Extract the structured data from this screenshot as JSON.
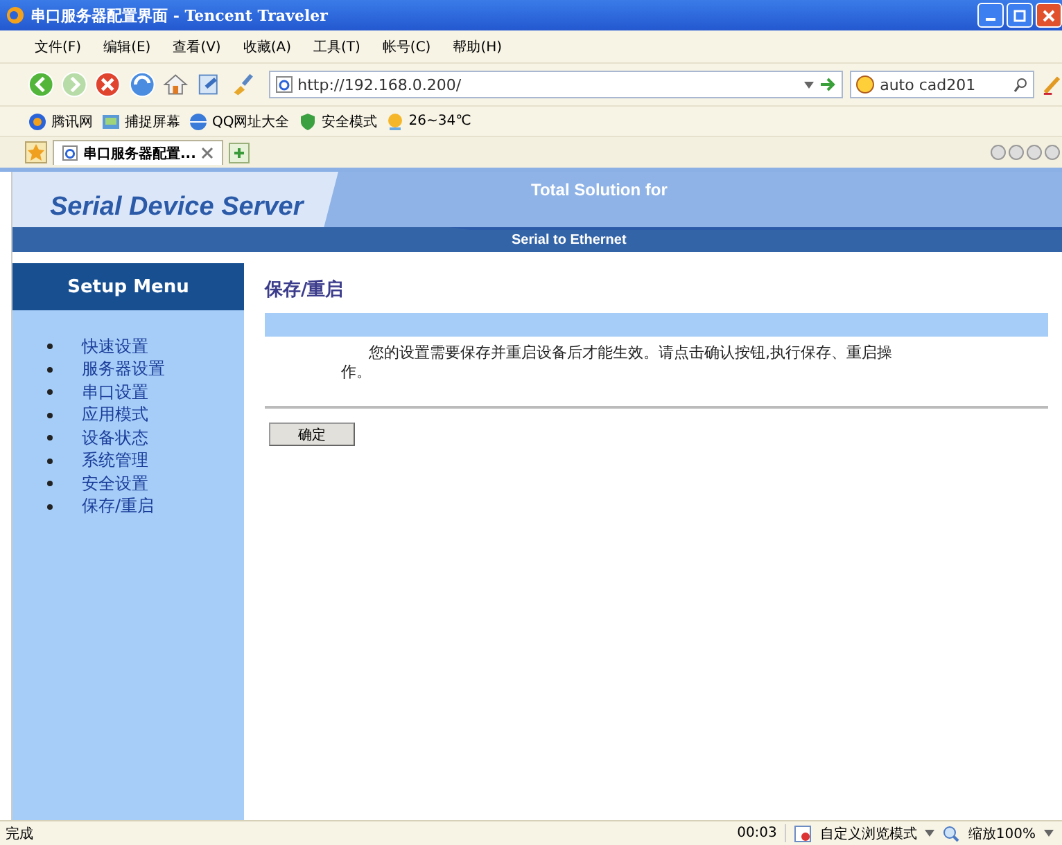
{
  "window": {
    "title": "串口服务器配置界面 - Tencent Traveler"
  },
  "menu": [
    {
      "label": "文件(F)"
    },
    {
      "label": "编辑(E)"
    },
    {
      "label": "查看(V)"
    },
    {
      "label": "收藏(A)"
    },
    {
      "label": "工具(T)"
    },
    {
      "label": "帐号(C)"
    },
    {
      "label": "帮助(H)"
    }
  ],
  "address": {
    "value": "http://192.168.0.200/"
  },
  "search": {
    "value": "auto cad201"
  },
  "links": [
    {
      "label": "腾讯网",
      "kind": "news"
    },
    {
      "label": "捕捉屏幕",
      "kind": "capture"
    },
    {
      "label": "QQ网址大全",
      "kind": "globe"
    },
    {
      "label": "安全模式",
      "kind": "shield"
    },
    {
      "label": "26~34℃",
      "kind": "weather"
    }
  ],
  "tabs": [
    {
      "label": "串口服务器配置...",
      "selected": true
    }
  ],
  "banner": {
    "title": "Serial Device Server",
    "tagline": "Total Solution for",
    "subtitle": "Serial to Ethernet"
  },
  "sidebar": {
    "heading": "Setup Menu",
    "items": [
      {
        "label": "快速设置"
      },
      {
        "label": "服务器设置"
      },
      {
        "label": "串口设置"
      },
      {
        "label": "应用模式"
      },
      {
        "label": "设备状态"
      },
      {
        "label": "系统管理"
      },
      {
        "label": "安全设置"
      },
      {
        "label": "保存/重启"
      }
    ]
  },
  "content": {
    "heading": "保存/重启",
    "message": "您的设置需要保存并重启设备后才能生效。请点击确认按钮,执行保存、重启操作。",
    "button": "确定"
  },
  "status_bar": {
    "text": "完成",
    "time": "00:03",
    "mode": "自定义浏览模式",
    "zoom": "缩放100%"
  }
}
